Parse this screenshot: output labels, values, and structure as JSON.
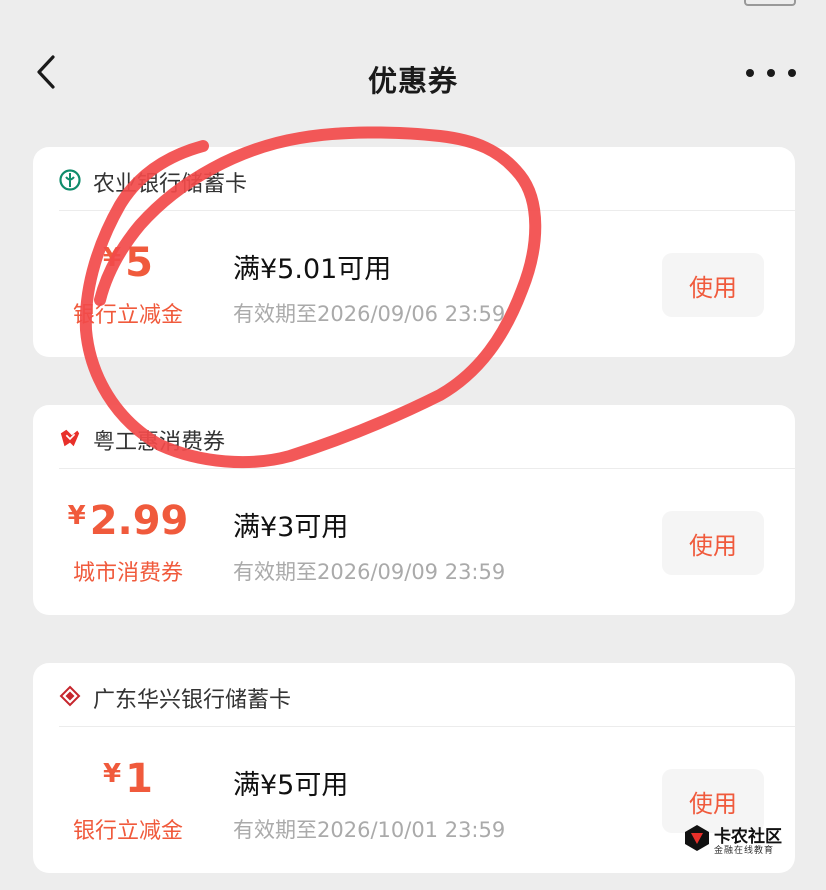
{
  "nav": {
    "title": "优惠券"
  },
  "coupons": [
    {
      "bank": "农业银行储蓄卡",
      "icon": "abc-bank-logo-icon",
      "currency": "¥",
      "amount": "5",
      "type_label": "银行立减金",
      "condition": "满¥5.01可用",
      "expiry": "有效期至2026/09/06 23:59",
      "button": "使用"
    },
    {
      "bank": "粤工惠消费券",
      "icon": "yuegonghui-logo-icon",
      "currency": "¥",
      "amount": "2.99",
      "type_label": "城市消费券",
      "condition": "满¥3可用",
      "expiry": "有效期至2026/09/09 23:59",
      "button": "使用"
    },
    {
      "bank": "广东华兴银行储蓄卡",
      "icon": "huaxing-bank-logo-icon",
      "currency": "¥",
      "amount": "1",
      "type_label": "银行立减金",
      "condition": "满¥5可用",
      "expiry": "有效期至2026/10/01 23:59",
      "button": "使用"
    }
  ],
  "watermark": {
    "title": "卡农社区",
    "subtitle": "金融在线教育"
  },
  "colors": {
    "accent": "#f05a3c",
    "annotation": "#f24a4a",
    "background": "#ededed"
  }
}
